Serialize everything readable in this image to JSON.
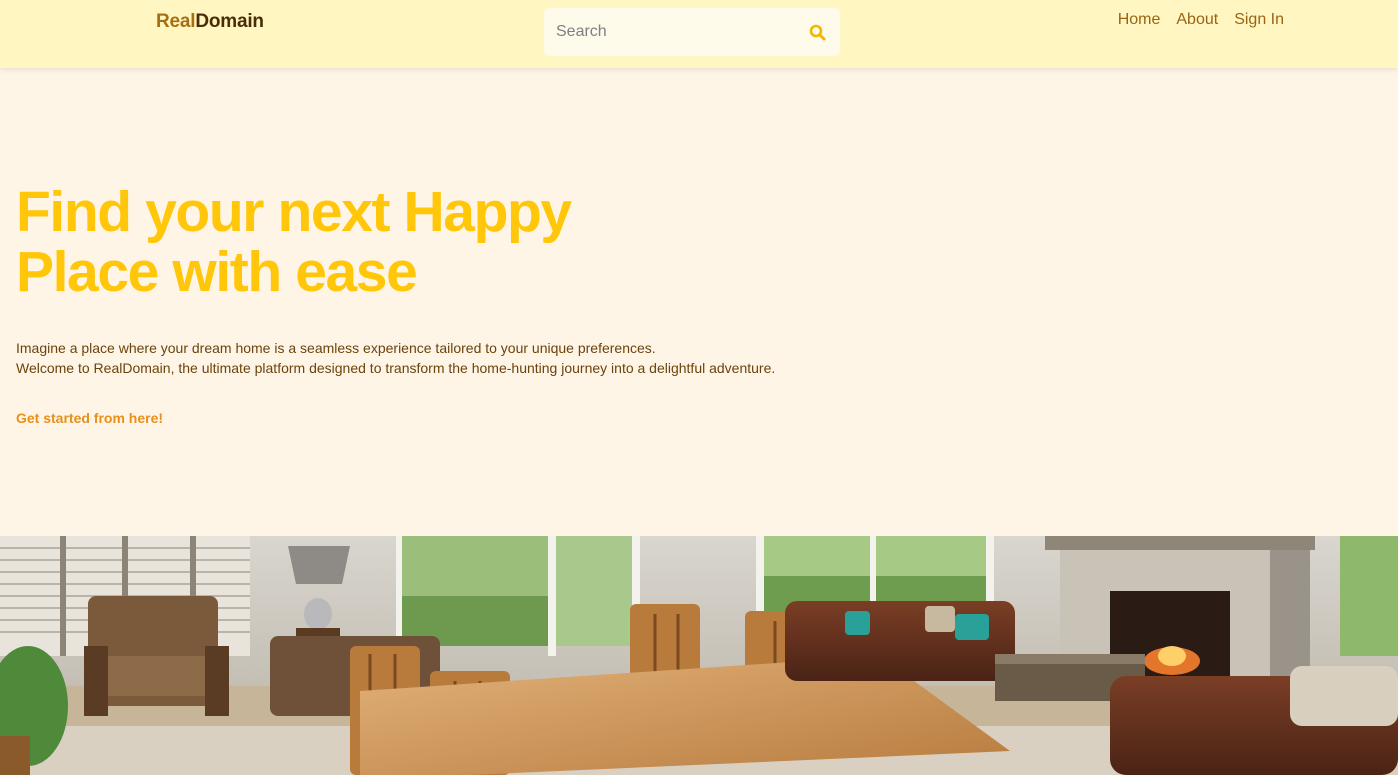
{
  "brand": {
    "part1": "Real",
    "part2": "Domain"
  },
  "search": {
    "placeholder": "Search"
  },
  "nav": {
    "home": "Home",
    "about": "About",
    "signin": "Sign In"
  },
  "hero": {
    "title_line1": "Find your next Happy",
    "title_line2": "Place with ease",
    "desc_line1": "Imagine a place where your dream home is a seamless experience tailored to your unique preferences.",
    "desc_line2": "Welcome to RealDomain, the ultimate platform designed to transform the home-hunting journey into a delightful adventure.",
    "cta": "Get started from here!"
  },
  "colors": {
    "navbar_bg": "#fff6c2",
    "page_bg": "#fff5e6",
    "headline": "#ffc60a",
    "link": "#9a6412",
    "cta": "#e8901a"
  },
  "icons": {
    "search": "search-icon"
  }
}
